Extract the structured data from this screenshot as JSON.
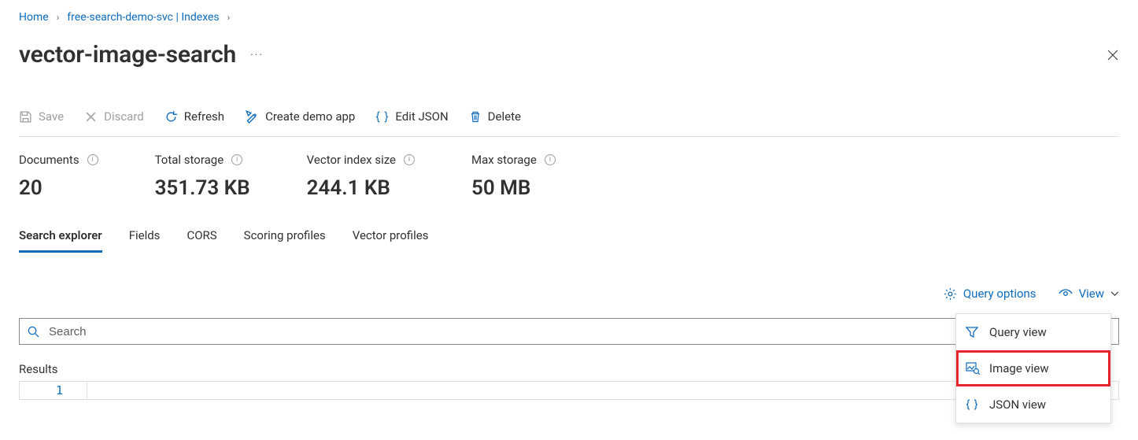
{
  "breadcrumb": {
    "home": "Home",
    "service": "free-search-demo-svc | Indexes"
  },
  "title": "vector-image-search",
  "toolbar": {
    "save": "Save",
    "discard": "Discard",
    "refresh": "Refresh",
    "create_demo": "Create demo app",
    "edit_json": "Edit JSON",
    "delete": "Delete"
  },
  "stats": {
    "documents": {
      "label": "Documents",
      "value": "20"
    },
    "total_storage": {
      "label": "Total storage",
      "value": "351.73 KB"
    },
    "vector_index": {
      "label": "Vector index size",
      "value": "244.1 KB"
    },
    "max_storage": {
      "label": "Max storage",
      "value": "50 MB"
    }
  },
  "tabs": {
    "search_explorer": "Search explorer",
    "fields": "Fields",
    "cors": "CORS",
    "scoring": "Scoring profiles",
    "vector": "Vector profiles"
  },
  "query_row": {
    "options": "Query options",
    "view": "View"
  },
  "view_menu": {
    "query": "Query view",
    "image": "Image view",
    "json": "JSON view"
  },
  "search": {
    "placeholder": "Search"
  },
  "results": {
    "label": "Results",
    "line": "1"
  }
}
